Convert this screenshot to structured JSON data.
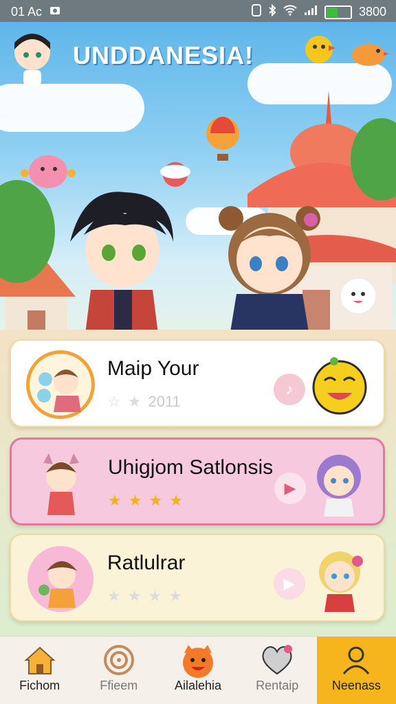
{
  "status_bar": {
    "time": "01 Ac",
    "right_text": "3800",
    "battery_level": 0.5,
    "icons": [
      "photo-icon",
      "nfc-icon",
      "bluetooth-icon",
      "wifi-icon",
      "signal-icon",
      "battery-icon"
    ]
  },
  "header": {
    "title": "UNDDANESIA!"
  },
  "cards": [
    {
      "title": "Maip Your",
      "year": "2011",
      "rating": 1,
      "max_rating": 2,
      "play_icon": "music-note-icon",
      "theme": "white"
    },
    {
      "title": "Uhigjom Satlonsis",
      "year": "",
      "rating": 4,
      "max_rating": 4,
      "play_icon": "play-icon",
      "theme": "pink"
    },
    {
      "title": "Ratlulrar",
      "year": "",
      "rating": 0,
      "max_rating": 4,
      "play_icon": "play-icon",
      "theme": "cream"
    }
  ],
  "nav": {
    "items": [
      {
        "label": "Fichom",
        "icon": "home-icon",
        "active": false
      },
      {
        "label": "Ffieem",
        "icon": "target-icon",
        "active": false
      },
      {
        "label": "Ailalehia",
        "icon": "cat-mascot-icon",
        "active": false
      },
      {
        "label": "Rentaip",
        "icon": "heart-icon",
        "active": false
      },
      {
        "label": "Neenass",
        "icon": "profile-icon",
        "active": true
      }
    ]
  },
  "colors": {
    "accent": "#f7b51d",
    "pink_card": "#f7c9df",
    "cream_card": "#fbf3d8",
    "title_shadow": "#3a86b8"
  }
}
